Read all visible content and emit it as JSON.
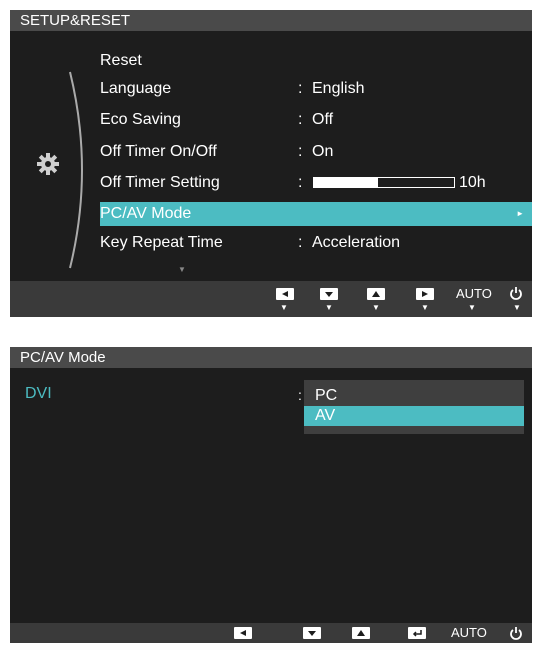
{
  "panel1": {
    "title": "SETUP&RESET",
    "items": [
      {
        "label": "Reset",
        "value": ""
      },
      {
        "label": "Language",
        "value": "English"
      },
      {
        "label": "Eco Saving",
        "value": "Off"
      },
      {
        "label": "Off Timer On/Off",
        "value": "On"
      },
      {
        "label": "Off Timer Setting",
        "value": "10h",
        "fraction": 0.46
      },
      {
        "label": "PC/AV Mode",
        "value": "",
        "selected": true
      },
      {
        "label": "Key Repeat Time",
        "value": "Acceleration"
      }
    ],
    "colon": ":",
    "buttons": [
      "left-icon",
      "down-icon",
      "up-icon",
      "right-icon"
    ],
    "auto_label": "AUTO"
  },
  "panel2": {
    "title": "PC/AV Mode",
    "row_label": "DVI",
    "colon": ":",
    "options": [
      {
        "label": "PC",
        "selected": false
      },
      {
        "label": "AV",
        "selected": true
      }
    ],
    "buttons": [
      "left-icon",
      "down-icon",
      "up-icon",
      "enter-icon"
    ],
    "auto_label": "AUTO"
  },
  "colors": {
    "accent": "#4cbcc2",
    "panel_bg": "#1d1d1d",
    "title_bg": "#4a4a4a",
    "bar_bg": "#3a3a3a"
  }
}
